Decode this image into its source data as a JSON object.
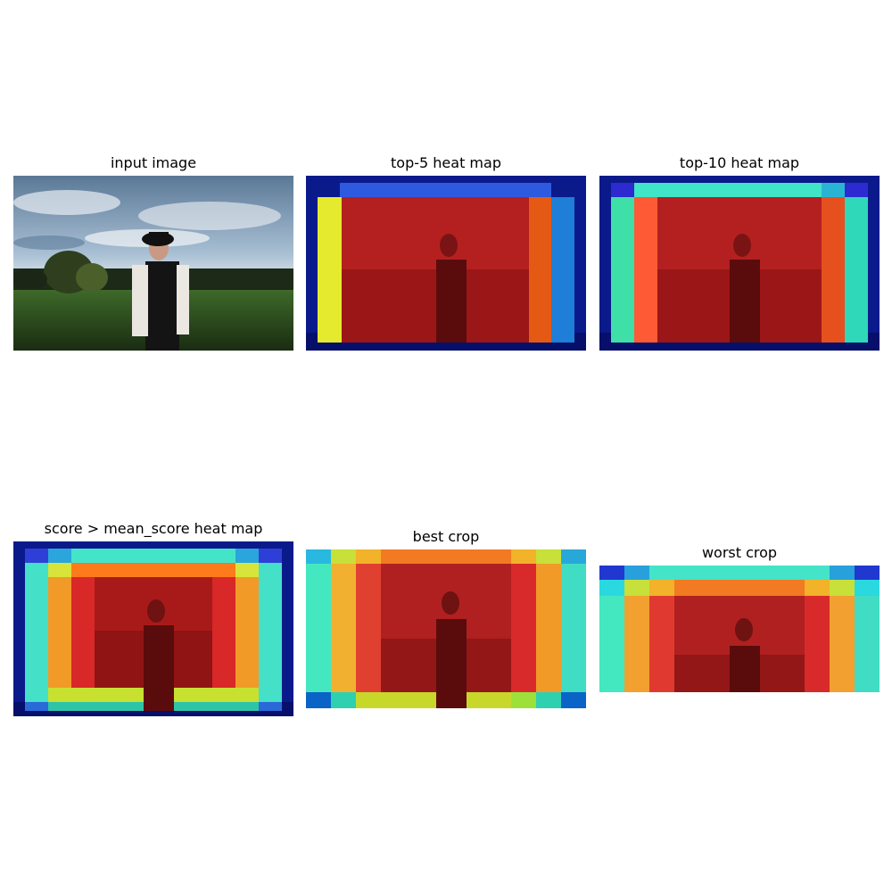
{
  "figure": {
    "panels": [
      {
        "id": "input",
        "title": "input image",
        "kind": "photo"
      },
      {
        "id": "top5",
        "title": "top-5 heat map",
        "kind": "heatmap"
      },
      {
        "id": "top10",
        "title": "top-10 heat map",
        "kind": "heatmap"
      },
      {
        "id": "mean",
        "title": "score > mean_score heat map",
        "kind": "heatmap"
      },
      {
        "id": "best",
        "title": "best crop",
        "kind": "crop"
      },
      {
        "id": "worst",
        "title": "worst crop",
        "kind": "crop"
      }
    ],
    "colormap": "jet",
    "colors": {
      "dark_blue": "#0b0f7a",
      "blue": "#1f6fe0",
      "cyan": "#40e0d0",
      "yellow": "#e8e82a",
      "orange": "#ff7a1a",
      "red": "#c81e1e"
    }
  }
}
